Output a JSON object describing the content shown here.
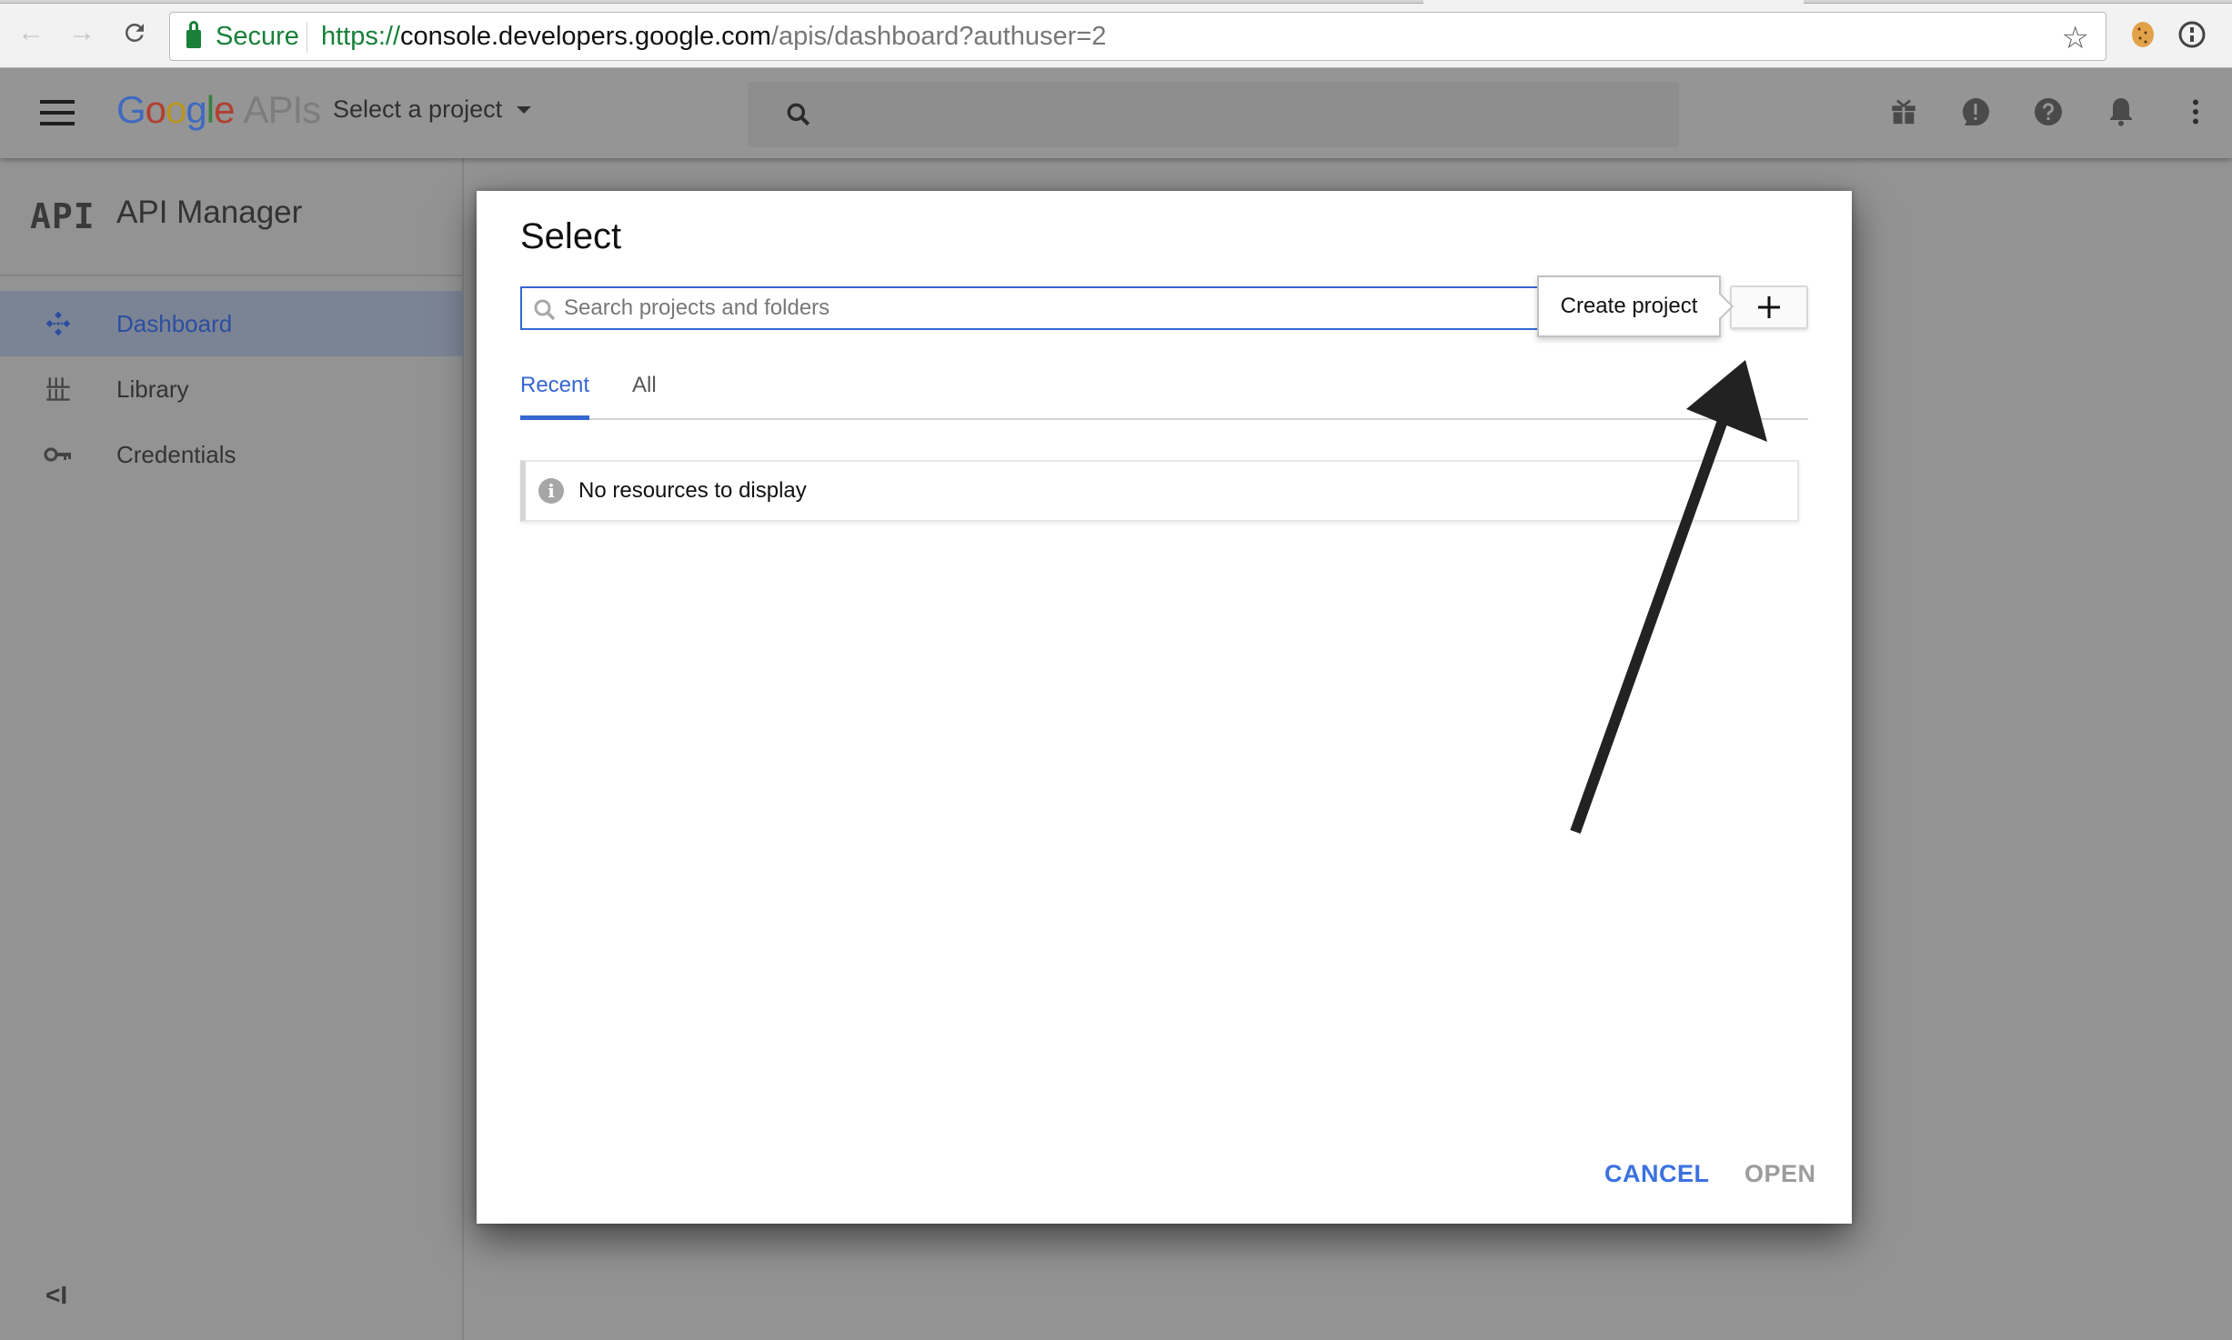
{
  "browser": {
    "nav": {
      "back_icon": "arrow-left-icon",
      "forward_icon": "arrow-right-icon",
      "reload_icon": "reload-icon"
    },
    "security_label": "Secure",
    "url": {
      "scheme": "https://",
      "host": "console.developers.google.com",
      "path": "/apis/dashboard?authuser=2"
    },
    "bookmark_icon": "star-icon",
    "extensions": [
      "cookie-icon",
      "password-manager-icon"
    ]
  },
  "appbar": {
    "menu_icon": "hamburger-icon",
    "logo": {
      "google": [
        "G",
        "o",
        "o",
        "g",
        "l",
        "e"
      ],
      "product": "APIs"
    },
    "project_selector": "Select a project",
    "search_icon": "search-icon",
    "actions": [
      "gift-icon",
      "feedback-icon",
      "help-icon",
      "notifications-icon",
      "more-vert-icon"
    ]
  },
  "sidebar": {
    "logo_text": "API",
    "title": "API Manager",
    "items": [
      {
        "label": "Dashboard",
        "icon": "dashboard-icon",
        "active": true
      },
      {
        "label": "Library",
        "icon": "library-icon",
        "active": false
      },
      {
        "label": "Credentials",
        "icon": "key-icon",
        "active": false
      }
    ],
    "collapse_label": "<I"
  },
  "dialog": {
    "title": "Select",
    "search_placeholder": "Search projects and folders",
    "tooltip": "Create project",
    "add_button": "+",
    "tabs": [
      {
        "label": "Recent",
        "active": true
      },
      {
        "label": "All",
        "active": false
      }
    ],
    "empty_message": "No resources to display",
    "cancel_label": "CANCEL",
    "open_label": "OPEN"
  },
  "colors": {
    "accent_blue": "#3566d1",
    "secure_green": "#188038",
    "overlay_gray": "#939393"
  }
}
